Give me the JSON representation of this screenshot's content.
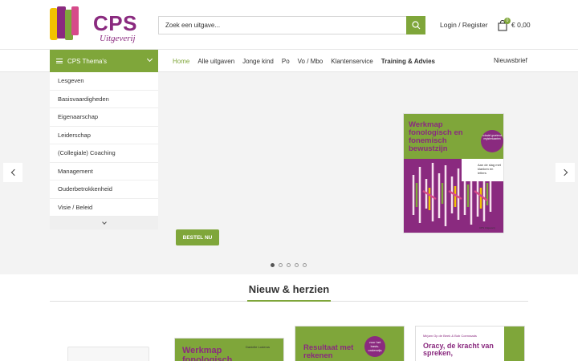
{
  "header": {
    "logo_name": "CPS",
    "logo_sub": "Uitgeverij",
    "search_placeholder": "Zoek een uitgave...",
    "login_label": "Login / Register",
    "cart_count": "0",
    "cart_total": "€ 0,00"
  },
  "nav": {
    "theme_label": "CPS Thema's",
    "items": [
      "Home",
      "Alle uitgaven",
      "Jonge kind",
      "Po",
      "Vo / Mbo",
      "Klantenservice",
      "Training & Advies"
    ],
    "active": "Home",
    "newsletter": "Nieuwsbrief"
  },
  "sidebar": {
    "items": [
      "Lesgeven",
      "Basisvaardigheden",
      "Eigenaarschap",
      "Leiderschap",
      "(Collegiale) Coaching",
      "Management",
      "Ouderbetrokkenheid",
      "Visie / Beleid"
    ]
  },
  "hero": {
    "order_label": "BESTEL NU",
    "book_title": "Werkmap fonologisch en fonemisch bewustzijn",
    "book_author": "Danielle Loderus",
    "book_sticker": "Aan de slag met klanken en letters",
    "book_badge": "Inclusief groeiende registerkaarten",
    "book_publisher": "CPS Uitgeverij",
    "slides": 5,
    "active_slide": 1
  },
  "section": {
    "title": "Nieuw & herzien",
    "products": [
      {
        "title": "Werkmap fonologisch",
        "author": "Danielle Loderus"
      },
      {
        "title": "Resultaat met rekenen",
        "badge": "voor het basis-onderwijs"
      },
      {
        "title": "Oracy, de kracht van spreken,",
        "author": "Mirjam Op de Beek & Bob Coenraads"
      }
    ]
  },
  "colors": {
    "brand_green": "#7fa63a",
    "brand_purple": "#8a2a7f"
  }
}
